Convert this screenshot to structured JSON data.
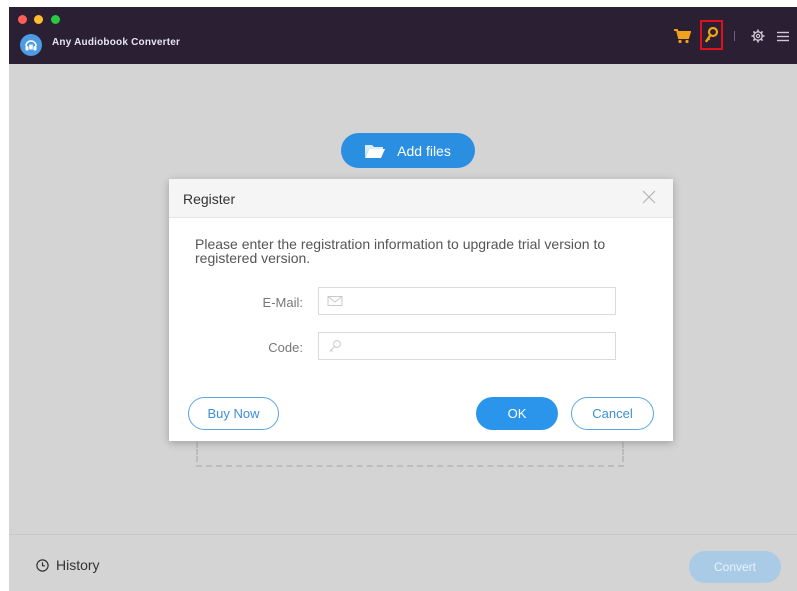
{
  "app": {
    "title": "Any Audiobook Converter"
  },
  "toolbar": {
    "icons": [
      "cart-icon",
      "key-icon",
      "gear-icon",
      "menu-icon"
    ],
    "highlight_color": "#e0101a",
    "icon_color": "#f0a21a"
  },
  "main": {
    "add_files_label": "Add files"
  },
  "dialog": {
    "title": "Register",
    "message": "Please enter the registration information to upgrade trial version to registered version.",
    "email_label": "E-Mail:",
    "email_value": "",
    "code_label": "Code:",
    "code_value": "",
    "buy_now_label": "Buy Now",
    "ok_label": "OK",
    "cancel_label": "Cancel"
  },
  "bottom": {
    "history_label": "History",
    "convert_label": "Convert"
  },
  "colors": {
    "titlebar": "#2a1f33",
    "accent": "#2a8fe1",
    "background": "#d4d4d4"
  }
}
